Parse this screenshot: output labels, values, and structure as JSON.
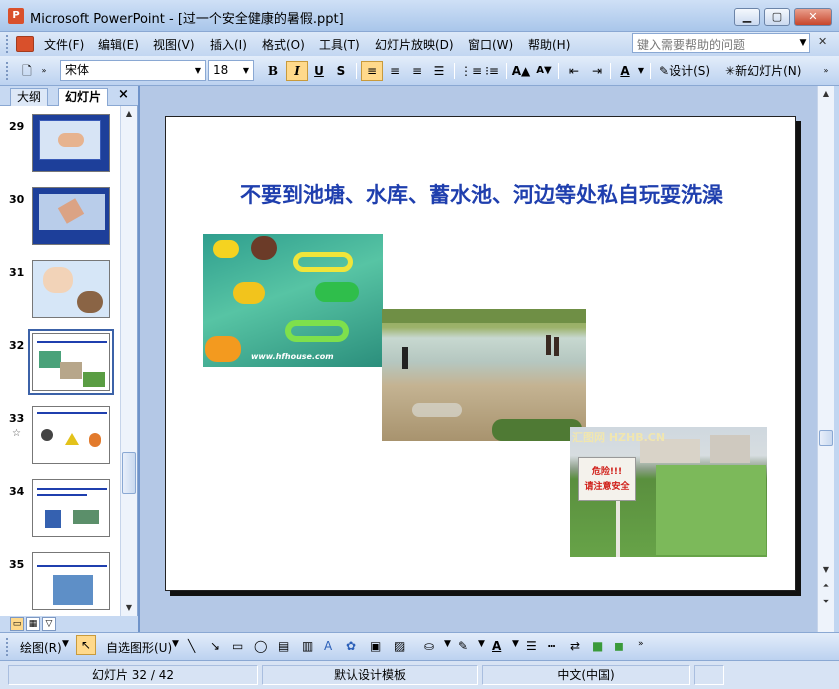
{
  "window": {
    "title": "Microsoft PowerPoint - [过一个安全健康的暑假.ppt]",
    "app_icon_label": "P",
    "buttons": [
      "minimize",
      "maximize",
      "close"
    ]
  },
  "menu": {
    "items": [
      "文件(F)",
      "编辑(E)",
      "视图(V)",
      "插入(I)",
      "格式(O)",
      "工具(T)",
      "幻灯片放映(D)",
      "窗口(W)",
      "帮助(H)"
    ],
    "help_placeholder": "键入需要帮助的问题"
  },
  "toolbar": {
    "font_name": "宋体",
    "font_size": "18",
    "bold": "B",
    "italic": "I",
    "underline": "U",
    "shadow": "S",
    "design_label": "设计(S)",
    "new_slide_label": "新幻灯片(N)"
  },
  "left_pane": {
    "tabs": [
      "大纲",
      "幻灯片"
    ],
    "close": "×",
    "thumbnails": [
      {
        "num": "29"
      },
      {
        "num": "30"
      },
      {
        "num": "31"
      },
      {
        "num": "32",
        "selected": true
      },
      {
        "num": "33",
        "star": "☆"
      },
      {
        "num": "34"
      },
      {
        "num": "35"
      }
    ]
  },
  "slide": {
    "title": "不要到池塘、水库、蓄水池、河边等处私自玩耍洗澡",
    "photo1_watermark": "www.hfhouse.com",
    "photo3_watermark": "汇图网 HZHB.CN",
    "sign_text_1": "危险!!!",
    "sign_text_2": "请注意安全"
  },
  "drawing": {
    "draw_label": "绘图(R)",
    "autoshapes_label": "自选图形(U)"
  },
  "status": {
    "slide_info": "幻灯片 32 / 42",
    "design": "默认设计模板",
    "language": "中文(中国)"
  },
  "colors": {
    "title_text": "#1f3fae",
    "chrome": "#c2d6f1",
    "workspace": "#b4c8e6"
  }
}
